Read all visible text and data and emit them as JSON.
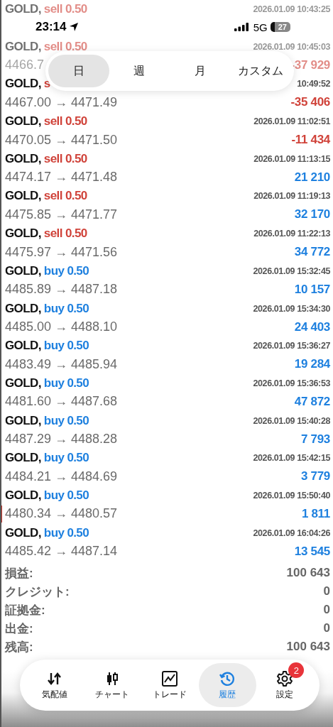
{
  "status_bar": {
    "time": "23:14",
    "network": "5G",
    "battery": "27"
  },
  "period_tabs": [
    {
      "label": "日",
      "selected": true
    },
    {
      "label": "週",
      "selected": false
    },
    {
      "label": "月",
      "selected": false
    },
    {
      "label": "カスタム",
      "selected": false
    }
  ],
  "deals": [
    {
      "symbol": "GOLD,",
      "side": "sell 0.50",
      "kind": "sell",
      "time": "2026.01.09 10:43:25",
      "faded": true,
      "selected": false
    },
    {
      "symbol": "GOLD,",
      "side": "sell 0.50",
      "kind": "sell",
      "time": "2026.01.09 10:45:03",
      "prices": "4466.7",
      "profit": "-37 929",
      "faded": true,
      "selected": false
    },
    {
      "symbol": "GOLD,",
      "side": "s",
      "kind": "sell",
      "time": "10:49:52",
      "prices": "4467.00 → 4471.49",
      "profit": "-35 406",
      "faded": false,
      "selected": false
    },
    {
      "symbol": "GOLD,",
      "side": "sell 0.50",
      "kind": "sell",
      "time": "2026.01.09 11:02:51",
      "prices": "4470.05 → 4471.50",
      "profit": "-11 434",
      "faded": false,
      "selected": false
    },
    {
      "symbol": "GOLD,",
      "side": "sell 0.50",
      "kind": "sell",
      "time": "2026.01.09 11:13:15",
      "prices": "4474.17 → 4471.48",
      "profit": "21 210",
      "faded": false,
      "selected": false
    },
    {
      "symbol": "GOLD,",
      "side": "sell 0.50",
      "kind": "sell",
      "time": "2026.01.09 11:19:13",
      "prices": "4475.85 → 4471.77",
      "profit": "32 170",
      "faded": false,
      "selected": false
    },
    {
      "symbol": "GOLD,",
      "side": "sell 0.50",
      "kind": "sell",
      "time": "2026.01.09 11:22:13",
      "prices": "4475.97 → 4471.56",
      "profit": "34 772",
      "faded": false,
      "selected": false
    },
    {
      "symbol": "GOLD,",
      "side": "buy 0.50",
      "kind": "buy",
      "time": "2026.01.09 15:32:45",
      "prices": "4485.89 → 4487.18",
      "profit": "10 157",
      "faded": false,
      "selected": false
    },
    {
      "symbol": "GOLD,",
      "side": "buy 0.50",
      "kind": "buy",
      "time": "2026.01.09 15:34:30",
      "prices": "4485.00 → 4488.10",
      "profit": "24 403",
      "faded": false,
      "selected": false
    },
    {
      "symbol": "GOLD,",
      "side": "buy 0.50",
      "kind": "buy",
      "time": "2026.01.09 15:36:27",
      "prices": "4483.49 → 4485.94",
      "profit": "19 284",
      "faded": false,
      "selected": false
    },
    {
      "symbol": "GOLD,",
      "side": "buy 0.50",
      "kind": "buy",
      "time": "2026.01.09 15:36:53",
      "prices": "4481.60 → 4487.68",
      "profit": "47 872",
      "faded": false,
      "selected": false
    },
    {
      "symbol": "GOLD,",
      "side": "buy 0.50",
      "kind": "buy",
      "time": "2026.01.09 15:40:28",
      "prices": "4487.29 → 4488.28",
      "profit": "7 793",
      "faded": false,
      "selected": false
    },
    {
      "symbol": "GOLD,",
      "side": "buy 0.50",
      "kind": "buy",
      "time": "2026.01.09 15:42:15",
      "prices": "4484.21 → 4484.69",
      "profit": "3 779",
      "faded": false,
      "selected": false
    },
    {
      "symbol": "GOLD,",
      "side": "buy 0.50",
      "kind": "buy",
      "time": "2026.01.09 15:50:40",
      "prices": "4480.34 → 4480.57",
      "profit": "1 811",
      "faded": false,
      "selected": true
    },
    {
      "symbol": "GOLD,",
      "side": "buy 0.50",
      "kind": "buy",
      "time": "2026.01.09 16:04:26",
      "prices": "4485.42 → 4487.14",
      "profit": "13 545",
      "faded": false,
      "selected": false
    }
  ],
  "summary": [
    {
      "label": "損益:",
      "value": "100 643"
    },
    {
      "label": "クレジット:",
      "value": "0"
    },
    {
      "label": "証拠金:",
      "value": "0"
    },
    {
      "label": "出金:",
      "value": "0"
    },
    {
      "label": "残高:",
      "value": "100 643"
    }
  ],
  "nav": [
    {
      "label": "気配値",
      "selected": false
    },
    {
      "label": "チャート",
      "selected": false
    },
    {
      "label": "トレード",
      "selected": false
    },
    {
      "label": "履歴",
      "selected": true
    },
    {
      "label": "設定",
      "selected": false,
      "badge": "2"
    }
  ]
}
